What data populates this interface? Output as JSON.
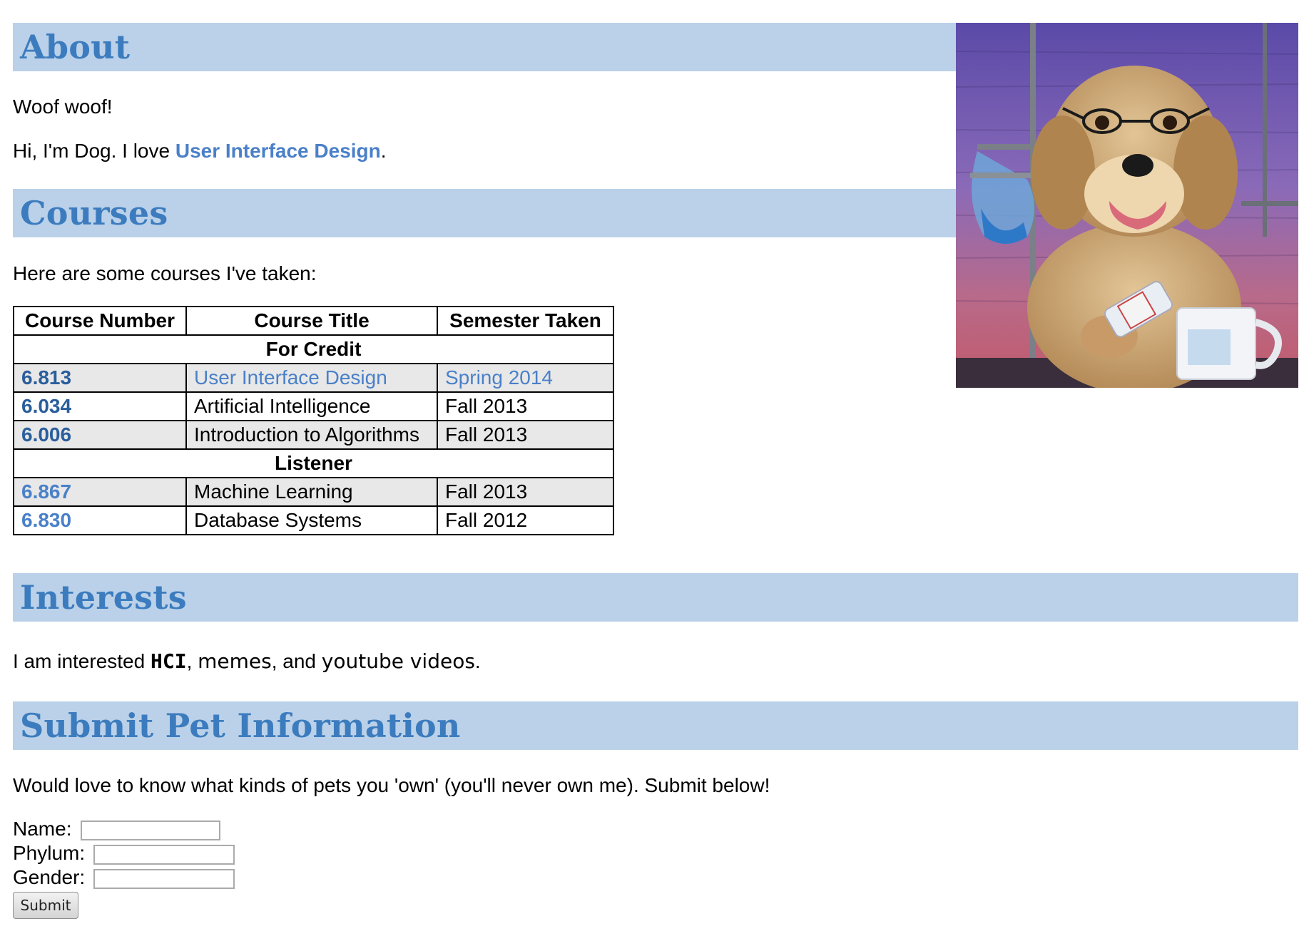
{
  "about": {
    "heading": "About",
    "line1": "Woof woof!",
    "line2_prefix": "Hi, I'm Dog. I love ",
    "line2_link": "User Interface Design",
    "line2_suffix": "."
  },
  "courses": {
    "heading": "Courses",
    "intro": "Here are some courses I've taken:",
    "columns": [
      "Course Number",
      "Course Title",
      "Semester Taken"
    ],
    "groups": [
      {
        "label": "For Credit",
        "rows": [
          {
            "number": "6.813",
            "title": "User Interface Design",
            "semester": "Spring 2014"
          },
          {
            "number": "6.034",
            "title": "Artificial Intelligence",
            "semester": "Fall 2013"
          },
          {
            "number": "6.006",
            "title": "Introduction to Algorithms",
            "semester": "Fall 2013"
          }
        ]
      },
      {
        "label": "Listener",
        "rows": [
          {
            "number": "6.867",
            "title": "Machine Learning",
            "semester": "Fall 2013"
          },
          {
            "number": "6.830",
            "title": "Database Systems",
            "semester": "Fall 2012"
          }
        ]
      }
    ]
  },
  "interests": {
    "heading": "Interests",
    "prefix": "I am interested ",
    "item1": "HCI",
    "sep1": ", ",
    "item2": "memes",
    "sep2": ", and ",
    "item3": "youtube videos",
    "suffix": "."
  },
  "submit": {
    "heading": "Submit Pet Information",
    "intro": "Would love to know what kinds of pets you 'own' (you'll never own me). Submit below!",
    "name_label": "Name:",
    "name_value": "",
    "phylum_label": "Phylum:",
    "phylum_value": "",
    "gender_label": "Gender:",
    "gender_value": "",
    "button_label": "Submit"
  },
  "colors": {
    "header_bg": "#bad1e9",
    "header_text": "#3c7cbe",
    "link": "#4a80c8"
  }
}
